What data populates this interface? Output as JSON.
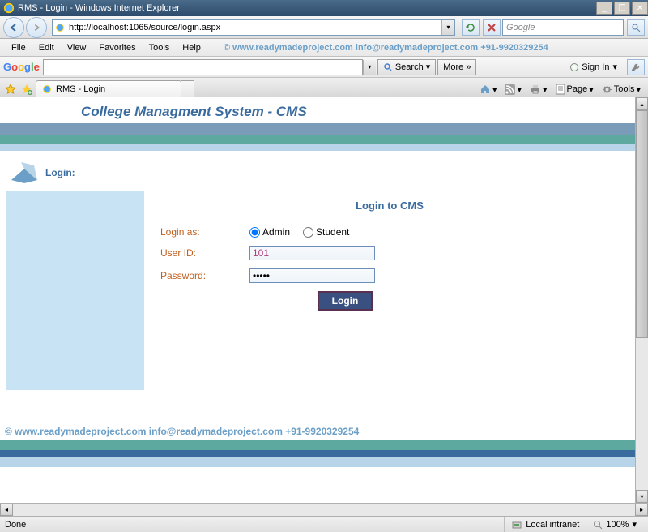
{
  "window": {
    "title": "RMS - Login - Windows Internet Explorer"
  },
  "nav": {
    "url": "http://localhost:1065/source/login.aspx",
    "search_placeholder": "Google"
  },
  "menu": {
    "items": [
      "File",
      "Edit",
      "View",
      "Favorites",
      "Tools",
      "Help"
    ],
    "watermark": "©  www.readymadeproject.com  info@readymadeproject.com  +91-9920329254"
  },
  "gbar": {
    "search_label": "Search",
    "more_label": "More",
    "signin_label": "Sign In"
  },
  "tab": {
    "title": "RMS - Login"
  },
  "toolbar": {
    "page_label": "Page",
    "tools_label": "Tools"
  },
  "page": {
    "header_title": "College Managment System - CMS",
    "login_section_label": "Login:",
    "form_title": "Login to CMS",
    "login_as_label": "Login as:",
    "radio_admin": "Admin",
    "radio_student": "Student",
    "userid_label": "User ID:",
    "userid_value": "101",
    "password_label": "Password:",
    "password_value": "•••••",
    "login_button": "Login",
    "footer_watermark": "©  www.readymadeproject.com  info@readymadeproject.com  +91-9920329254"
  },
  "status": {
    "done": "Done",
    "zone": "Local intranet",
    "zoom": "100%"
  }
}
